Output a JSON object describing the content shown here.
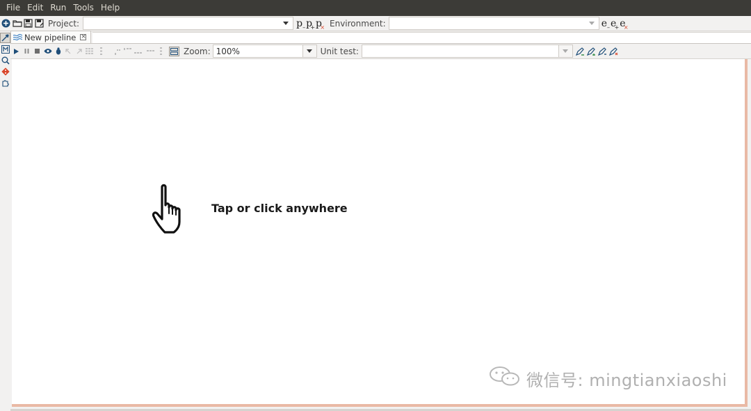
{
  "menu": {
    "items": [
      "File",
      "Edit",
      "Run",
      "Tools",
      "Help"
    ]
  },
  "toolbar": {
    "project_label": "Project:",
    "project_value": "",
    "environment_label": "Environment:",
    "environment_value": "",
    "project_icons": [
      "p-new-icon",
      "p-edit-icon",
      "p-delete-icon"
    ],
    "environment_icons": [
      "e-new-icon",
      "e-edit-icon",
      "e-delete-icon"
    ]
  },
  "tabs": [
    {
      "label": "New pipeline",
      "icon": "pipeline-icon",
      "active": true
    }
  ],
  "pipeline_toolbar": {
    "zoom_label": "Zoom:",
    "zoom_value": "100%",
    "unit_test_label": "Unit test:",
    "unit_test_value": ""
  },
  "canvas": {
    "hint": "Tap or click anywhere"
  },
  "watermark": {
    "text": "微信号: mingtianxiaoshi"
  },
  "colors": {
    "menubar_bg": "#3c3b37",
    "accent_border": "#e9b9a5",
    "icon_blue": "#2c6fb5",
    "icon_red": "#d9462b"
  }
}
